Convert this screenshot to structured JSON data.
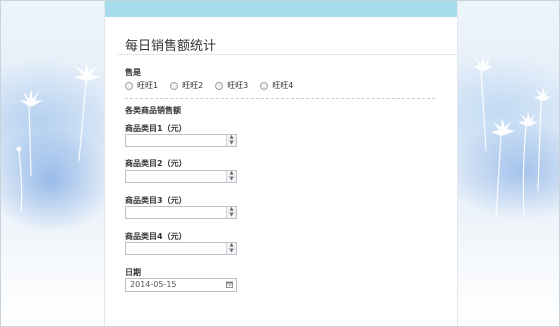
{
  "form": {
    "title": "每日销售额统计",
    "store_label": "售是",
    "store_options": [
      "旺旺1",
      "旺旺2",
      "旺旺3",
      "旺旺4"
    ],
    "section_label": "各类商品销售额",
    "category_fields": [
      {
        "label": "商品类目1（元）",
        "value": ""
      },
      {
        "label": "商品类目2（元）",
        "value": ""
      },
      {
        "label": "商品类目3（元）",
        "value": ""
      },
      {
        "label": "商品类目4（元）",
        "value": ""
      }
    ],
    "date_label": "日期",
    "date_value": "2014-05-15"
  },
  "colors": {
    "header_bar": "#a6dcec",
    "background_blue": "#6fa3e0"
  },
  "icons": {
    "spin_up": "spinner-up-icon",
    "spin_down": "spinner-down-icon",
    "calendar": "calendar-icon"
  }
}
